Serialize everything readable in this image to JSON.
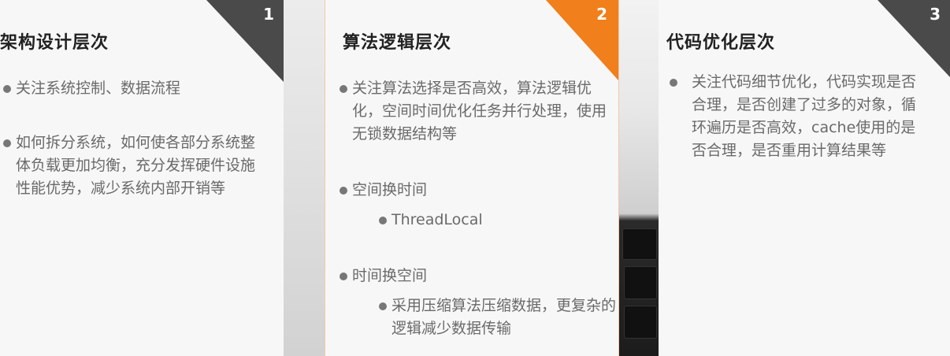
{
  "panels": [
    {
      "number": "1",
      "title": "架构设计层次",
      "bullets": [
        "关注系统控制、数据流程",
        "如何拆分系统，如何使各部分系统整体负载更加均衡，充分发挥硬件设施性能优势，减少系统内部开销等"
      ]
    },
    {
      "number": "2",
      "title": "算法逻辑层次",
      "bullets": [
        "关注算法选择是否高效，算法逻辑优化，空间时间优化任务并行处理，使用无锁数据结构等",
        "空间换时间",
        "ThreadLocal",
        "时间换空间",
        "采用压缩算法压缩数据，更复杂的逻辑减少数据传输"
      ]
    },
    {
      "number": "3",
      "title": "代码优化层次",
      "bullets": [
        "关注代码细节优化，代码实现是否合理，是否创建了过多的对象，循环遍历是否高效，cache使用的是否合理，是否重用计算结果等"
      ]
    }
  ],
  "colors": {
    "accent": "#f07f1c",
    "corner_dark": "#4a4a4a"
  }
}
